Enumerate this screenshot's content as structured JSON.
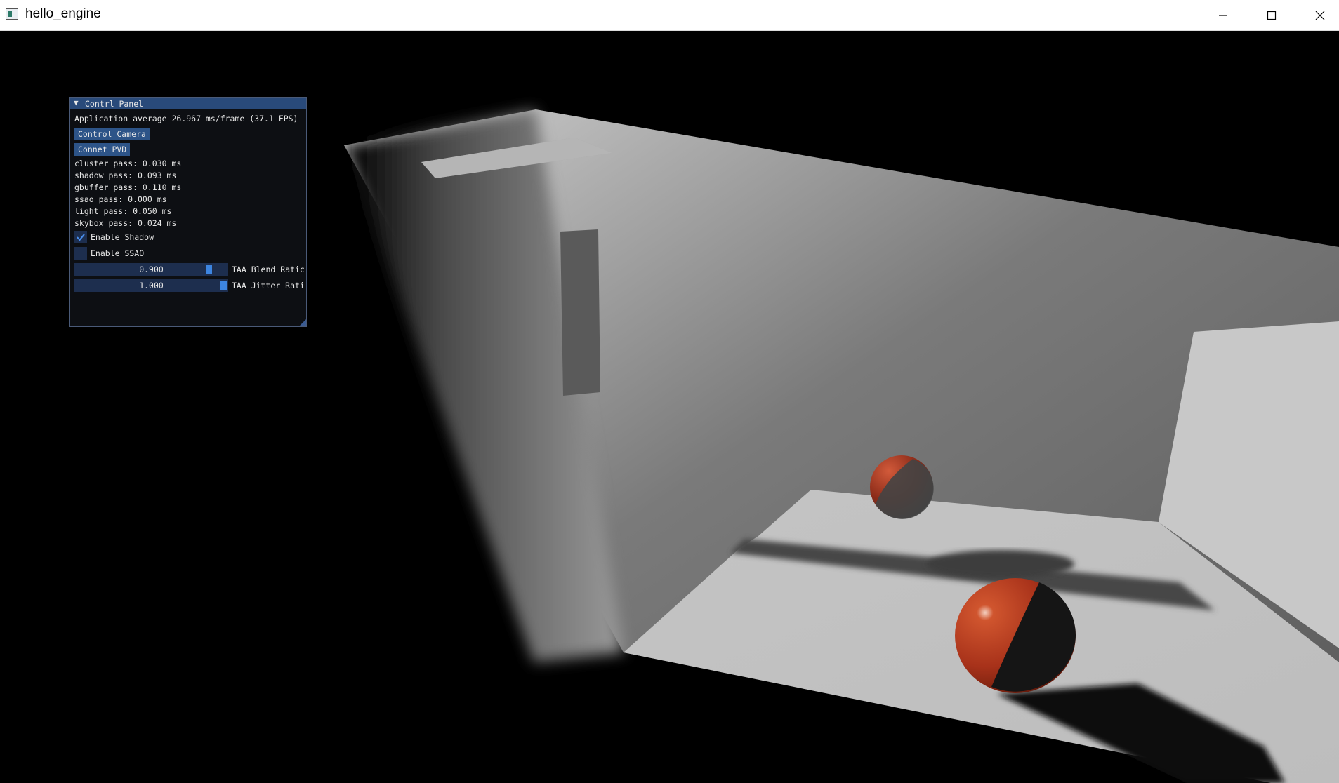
{
  "window": {
    "title": "hello_engine",
    "controls": [
      "minimize-icon",
      "maximize-icon",
      "close-icon"
    ]
  },
  "panel": {
    "title": "Contrl Panel",
    "collapse_icon": "triangle-down-icon",
    "fps_line": "Application average 26.967 ms/frame (37.1 FPS)",
    "buttons": {
      "control_camera": "Control Camera",
      "connect_pvd": "Connet PVD"
    },
    "passes": [
      "cluster pass: 0.030 ms",
      "shadow pass: 0.093 ms",
      "gbuffer pass: 0.110 ms",
      "ssao pass: 0.000 ms",
      "light pass: 0.050 ms",
      "skybox pass: 0.024 ms"
    ],
    "checkboxes": [
      {
        "label": "Enable Shadow",
        "checked": true
      },
      {
        "label": "Enable SSAO",
        "checked": false
      }
    ],
    "sliders": [
      {
        "label": "TAA Blend Ratic",
        "value_text": "0.900",
        "value": 0.9
      },
      {
        "label": "TAA Jitter Rati",
        "value_text": "1.000",
        "value": 1.0
      }
    ]
  },
  "colors": {
    "panel_header": "#294a7a",
    "button": "#2d5488",
    "frame": "#1d2e4e",
    "slider_grab": "#3d85e0",
    "sphere": "#b53a1e"
  }
}
